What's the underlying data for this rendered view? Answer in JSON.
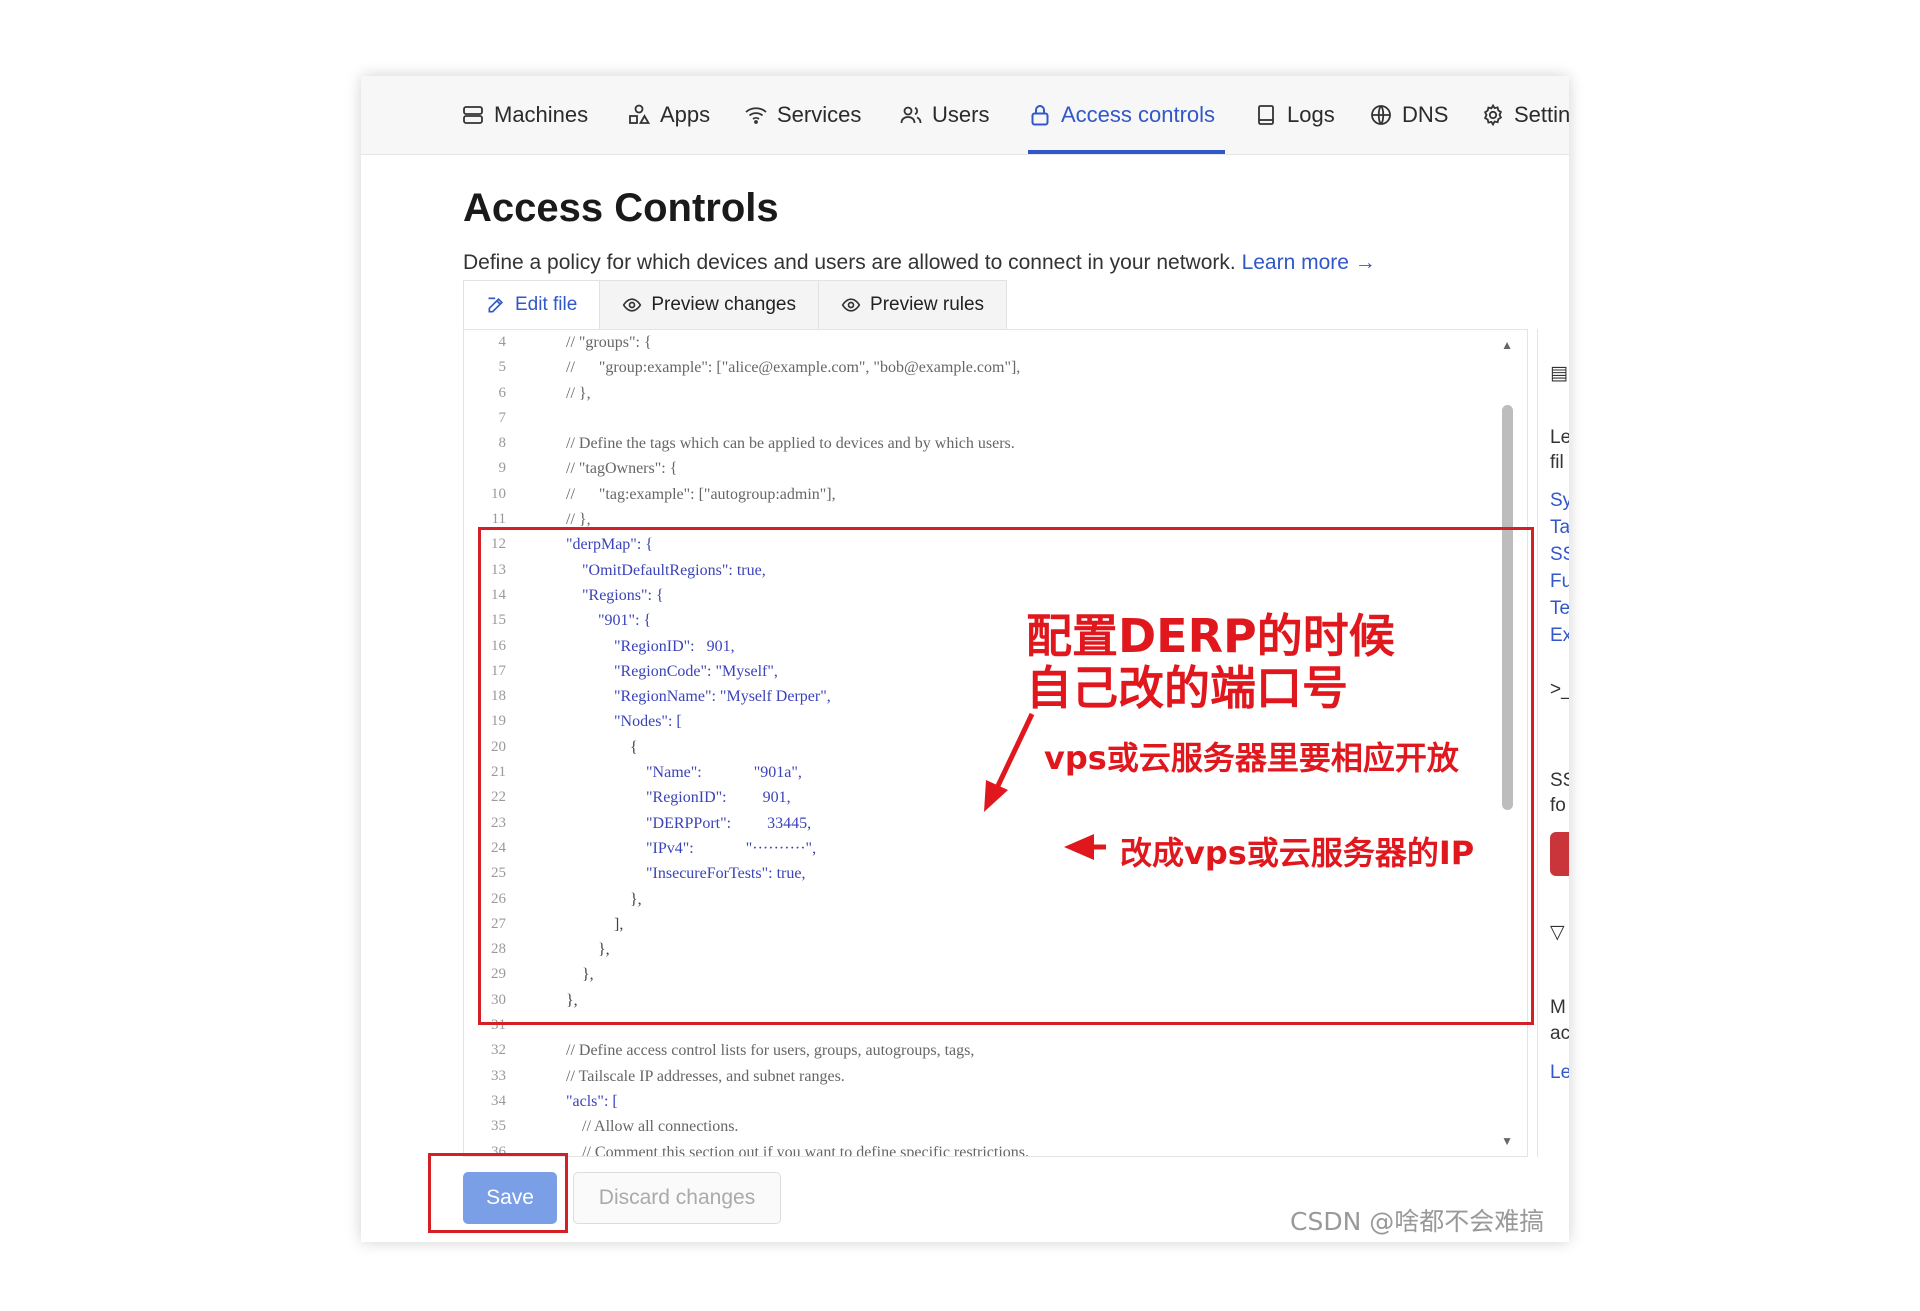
{
  "nav": {
    "items": [
      {
        "label": "Machines",
        "icon": "machines-icon"
      },
      {
        "label": "Apps",
        "icon": "apps-icon"
      },
      {
        "label": "Services",
        "icon": "wifi-icon"
      },
      {
        "label": "Users",
        "icon": "users-icon"
      },
      {
        "label": "Access controls",
        "icon": "lock-icon"
      },
      {
        "label": "Logs",
        "icon": "logs-icon"
      },
      {
        "label": "DNS",
        "icon": "globe-icon"
      },
      {
        "label": "Settin",
        "icon": "gear-icon"
      }
    ],
    "active": "Access controls",
    "accent_color": "#3157c9"
  },
  "page": {
    "title": "Access Controls",
    "description": "Define a policy for which devices and users are allowed to connect in your network.",
    "learn_more": "Learn more →"
  },
  "tabs": [
    {
      "label": "Edit file",
      "icon": "edit-icon"
    },
    {
      "label": "Preview changes",
      "icon": "eye-icon"
    },
    {
      "label": "Preview rules",
      "icon": "eye-icon"
    }
  ],
  "code_lines": [
    {
      "n": "4",
      "t": "// \"groups\": {"
    },
    {
      "n": "5",
      "t": "//      \"group:example\": [\"alice@example.com\", \"bob@example.com\"],"
    },
    {
      "n": "6",
      "t": "// },"
    },
    {
      "n": "7",
      "t": ""
    },
    {
      "n": "8",
      "t": "// Define the tags which can be applied to devices and by which users."
    },
    {
      "n": "9",
      "t": "// \"tagOwners\": {"
    },
    {
      "n": "10",
      "t": "//      \"tag:example\": [\"autogroup:admin\"],"
    },
    {
      "n": "11",
      "t": "// },"
    },
    {
      "n": "12",
      "t": "\"derpMap\": {"
    },
    {
      "n": "13",
      "t": "    \"OmitDefaultRegions\": true,"
    },
    {
      "n": "14",
      "t": "    \"Regions\": {"
    },
    {
      "n": "15",
      "t": "        \"901\": {"
    },
    {
      "n": "16",
      "t": "            \"RegionID\":   901,"
    },
    {
      "n": "17",
      "t": "            \"RegionCode\": \"Myself\","
    },
    {
      "n": "18",
      "t": "            \"RegionName\": \"Myself Derper\","
    },
    {
      "n": "19",
      "t": "            \"Nodes\": ["
    },
    {
      "n": "20",
      "t": "                {"
    },
    {
      "n": "21",
      "t": "                    \"Name\":             \"901a\","
    },
    {
      "n": "22",
      "t": "                    \"RegionID\":         901,"
    },
    {
      "n": "23",
      "t": "                    \"DERPPort\":         33445,"
    },
    {
      "n": "24",
      "t": "                    \"IPv4\":             \"··········\","
    },
    {
      "n": "25",
      "t": "                    \"InsecureForTests\": true,"
    },
    {
      "n": "26",
      "t": "                },"
    },
    {
      "n": "27",
      "t": "            ],"
    },
    {
      "n": "28",
      "t": "        },"
    },
    {
      "n": "29",
      "t": "    },"
    },
    {
      "n": "30",
      "t": "},"
    },
    {
      "n": "31",
      "t": ""
    },
    {
      "n": "32",
      "t": "// Define access control lists for users, groups, autogroups, tags,"
    },
    {
      "n": "33",
      "t": "// Tailscale IP addresses, and subnet ranges."
    },
    {
      "n": "34",
      "t": "\"acls\": ["
    },
    {
      "n": "35",
      "t": "    // Allow all connections."
    },
    {
      "n": "36",
      "t": "    // Comment this section out if you want to define specific restrictions."
    }
  ],
  "sidebar_fragments": [
    "Le",
    "fil",
    "Sy",
    "Ta",
    "SS",
    "Fu",
    "Te",
    "Ex",
    ">_",
    "SS",
    "fo",
    "M",
    "ac",
    "Le"
  ],
  "annotations": {
    "title_line1": "配置DERP的时候",
    "title_line2": "自己改的端口号",
    "port_note": "vps或云服务器里要相应开放",
    "ip_note": "改成vps或云服务器的IP",
    "color": "#e1171e"
  },
  "buttons": {
    "save": "Save",
    "discard": "Discard changes"
  },
  "watermark": "CSDN @啥都不会难搞"
}
